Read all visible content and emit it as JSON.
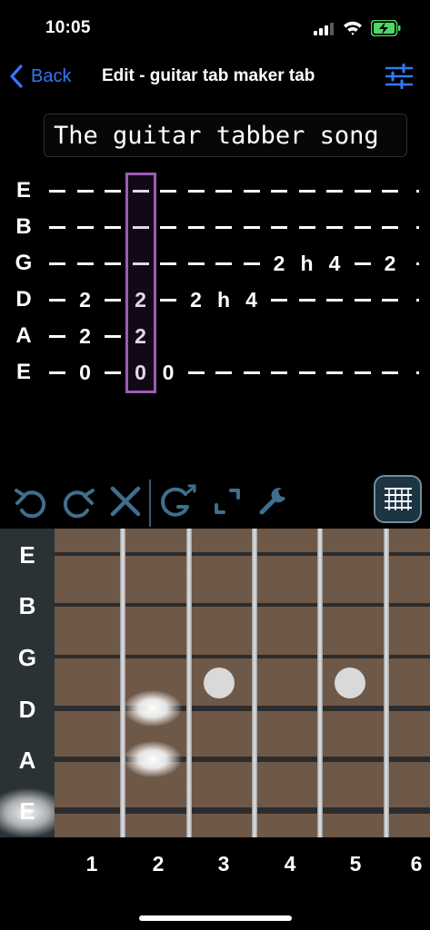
{
  "status_bar": {
    "time": "10:05"
  },
  "nav": {
    "back_label": "Back",
    "title": "Edit - guitar tab maker tab",
    "settings_icon": "sliders-icon"
  },
  "song": {
    "title": "The guitar tabber song"
  },
  "tab": {
    "strings": [
      {
        "name": "E",
        "cells": [
          "-",
          "-",
          "-",
          "-",
          "-",
          "-",
          "-",
          "-",
          "-",
          "-",
          "-",
          "-",
          "-",
          "."
        ]
      },
      {
        "name": "B",
        "cells": [
          "-",
          "-",
          "-",
          "-",
          "-",
          "-",
          "-",
          "-",
          "-",
          "-",
          "-",
          "-",
          "-",
          "."
        ]
      },
      {
        "name": "G",
        "cells": [
          "-",
          "-",
          "-",
          "-",
          "-",
          "-",
          "-",
          "-",
          "2",
          "h",
          "4",
          "-",
          "2",
          "."
        ]
      },
      {
        "name": "D",
        "cells": [
          "-",
          "2",
          "-",
          "2",
          "-",
          "2",
          "h",
          "4",
          "-",
          "-",
          "-",
          "-",
          "-",
          "."
        ]
      },
      {
        "name": "A",
        "cells": [
          "-",
          "2",
          "-",
          "2",
          "",
          "",
          "",
          "",
          "",
          "",
          "",
          "",
          "",
          ""
        ]
      },
      {
        "name": "E",
        "cells": [
          "-",
          "0",
          "-",
          "0",
          "0",
          "-",
          "-",
          "-",
          "-",
          "-",
          "-",
          "-",
          "-",
          "."
        ]
      }
    ],
    "cursor_column": 3
  },
  "toolbar": {
    "tools": [
      "undo-icon",
      "redo-icon",
      "delete-icon",
      "guitar-mode-icon",
      "expand-icon",
      "wrench-icon"
    ],
    "grid_icon": "grid-icon"
  },
  "fretboard": {
    "strings": [
      "E",
      "B",
      "G",
      "D",
      "A",
      "E"
    ],
    "fret_numbers": [
      "1",
      "2",
      "3",
      "4",
      "5",
      "6"
    ],
    "inlay_frets": [
      3,
      5
    ],
    "pressed_notes": [
      {
        "string": "D",
        "fret": 2
      },
      {
        "string": "A",
        "fret": 2
      }
    ],
    "open_strings": [
      "E"
    ]
  },
  "colors": {
    "accent": "#3478f6",
    "cursor": "#9c5bb3",
    "fretboard_wood": "#6e5848",
    "toolbar_icon": "#3f6f8c",
    "battery": "#4cd964"
  }
}
